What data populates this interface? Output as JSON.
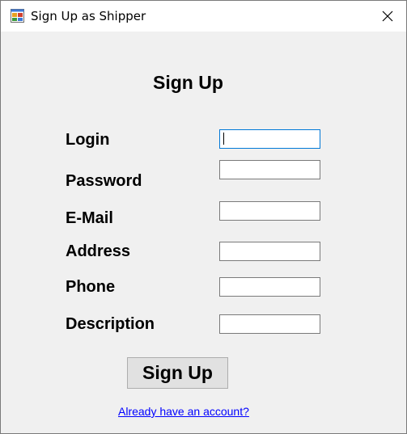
{
  "window": {
    "title": "Sign Up as Shipper",
    "icon": "form-app-icon"
  },
  "form": {
    "heading": "Sign Up",
    "fields": [
      {
        "label": "Login",
        "value": "",
        "focused": true
      },
      {
        "label": "Password",
        "value": ""
      },
      {
        "label": "E-Mail",
        "value": ""
      },
      {
        "label": "Address",
        "value": ""
      },
      {
        "label": "Phone",
        "value": ""
      },
      {
        "label": "Description",
        "value": ""
      }
    ],
    "submit_label": "Sign Up",
    "login_link": "Already have an account?"
  },
  "colors": {
    "window_bg": "#f0f0f0",
    "focus_border": "#0078d7",
    "link": "#0000ff"
  }
}
